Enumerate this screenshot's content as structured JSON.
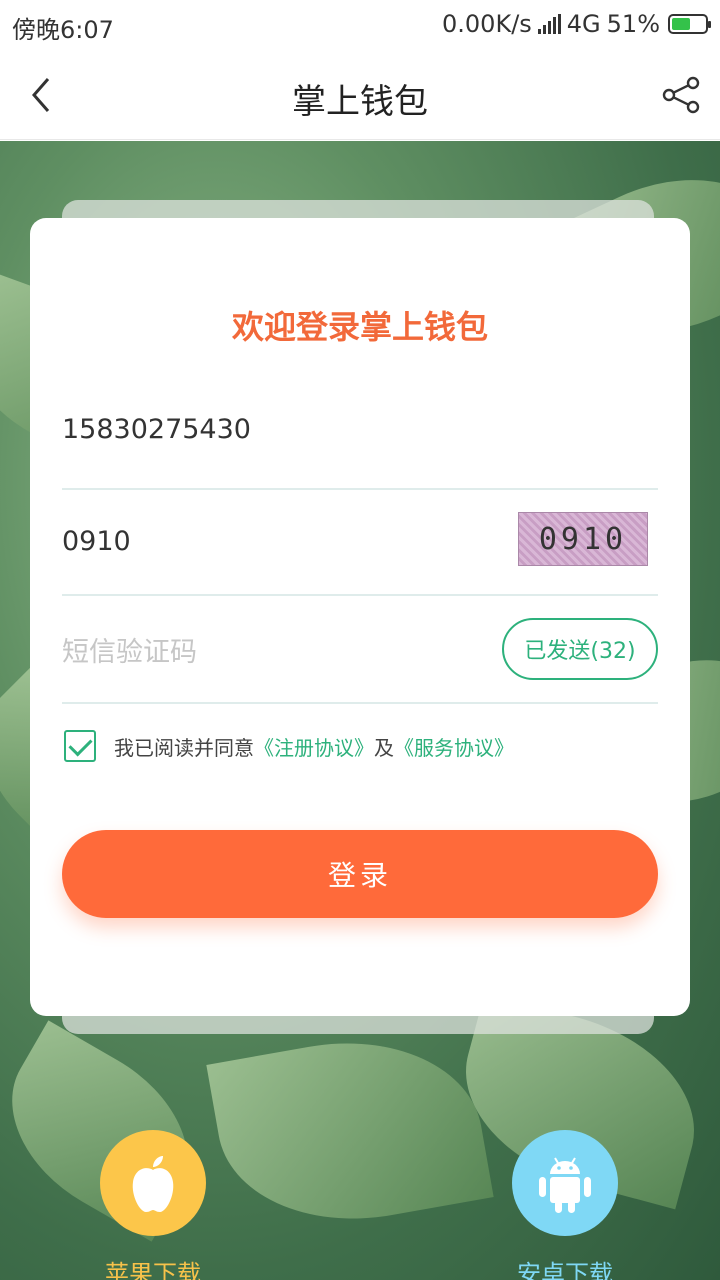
{
  "status_bar": {
    "time": "傍晚6:07",
    "network_speed": "0.00K/s",
    "network_type": "4G",
    "battery": "51%"
  },
  "header": {
    "title": "掌上钱包"
  },
  "login": {
    "welcome": "欢迎登录掌上钱包",
    "phone_value": "15830275430",
    "captcha_value": "0910",
    "captcha_image_text": "0910",
    "sms_placeholder": "短信验证码",
    "sms_button": "已发送(32)",
    "agree_prefix": "我已阅读并同意",
    "register_link": "《注册协议》",
    "agree_and": "及",
    "service_link": "《服务协议》",
    "login_button": "登录"
  },
  "downloads": {
    "apple_label": "苹果下载",
    "android_label": "安卓下载"
  },
  "colors": {
    "accent_orange": "#ff6a3a",
    "accent_green": "#2db17c",
    "apple_yellow": "#fcc64a",
    "android_blue": "#7fd8f5"
  }
}
